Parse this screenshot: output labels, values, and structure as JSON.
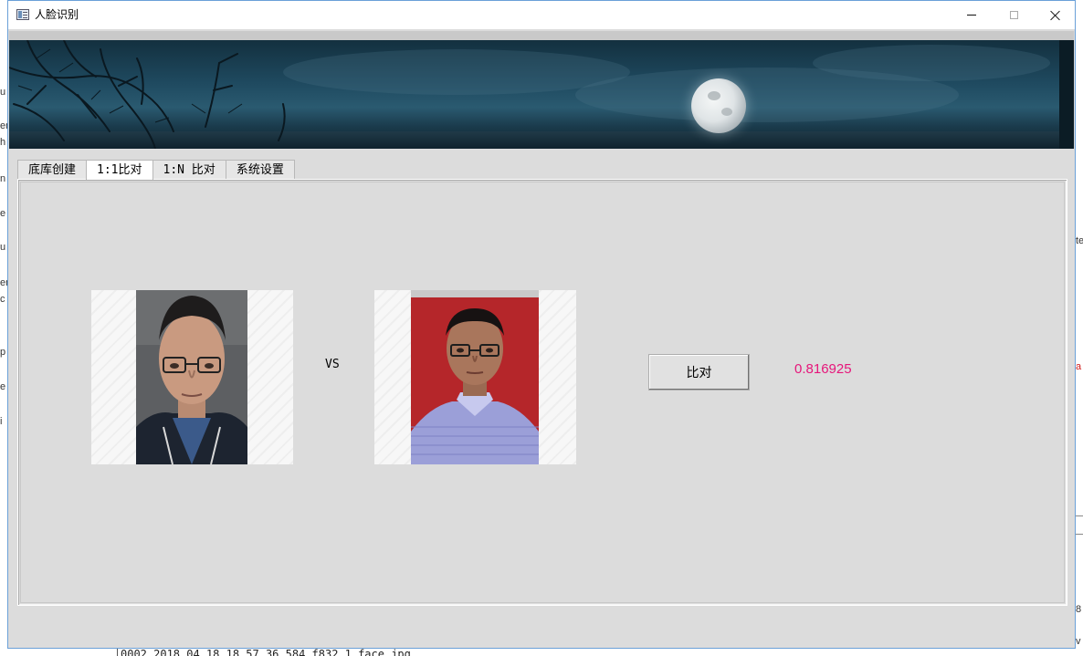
{
  "window": {
    "title": "人脸识别",
    "min_label": "",
    "max_label": "",
    "close_label": ""
  },
  "tabs": [
    {
      "label": "底库创建",
      "active": false
    },
    {
      "label": "1:1比对",
      "active": true
    },
    {
      "label": "1:N 比对",
      "active": false
    },
    {
      "label": "系统设置",
      "active": false
    }
  ],
  "compare": {
    "vs_label": "VS",
    "button_label": "比对",
    "score": "0.816925"
  },
  "background": {
    "console_line": "0002_2018_04_18_18_57_36_584_f832_1_face.jpg"
  },
  "colors": {
    "score": "#e6157a",
    "window_border": "#6aa0d8"
  }
}
